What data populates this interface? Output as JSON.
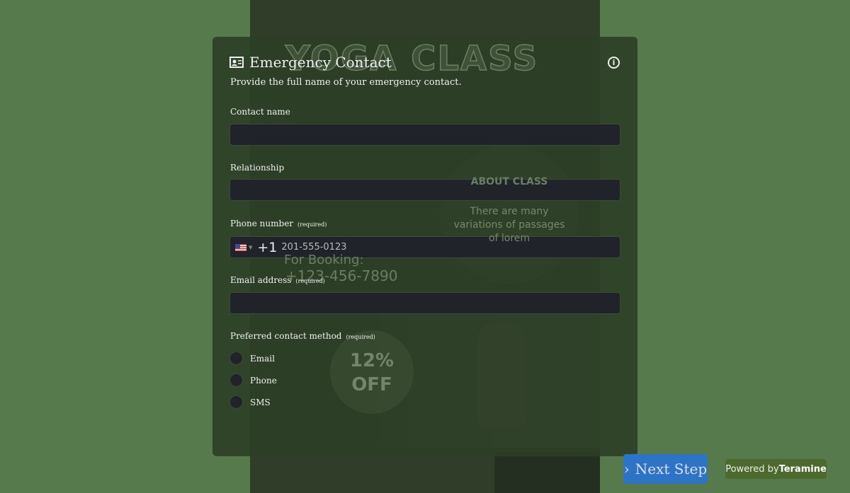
{
  "poster": {
    "title": "YOGA CLASS",
    "about": "ABOUT CLASS",
    "desc": "There are many variations of passages of lorem",
    "booking": "For Booking:",
    "phone": "+123-456-7890",
    "discount": "12% OFF"
  },
  "form": {
    "title": "Emergency Contact",
    "subtitle": "Provide the full name of your emergency contact.",
    "fields": [
      {
        "label": "Contact name",
        "value": ""
      },
      {
        "label": "Relationship",
        "value": ""
      },
      {
        "label": "Phone number",
        "required": "(required)",
        "country_code": "+1",
        "placeholder": "201-555-0123"
      },
      {
        "label": "Email address",
        "required": "(required)",
        "value": ""
      }
    ],
    "contact_method": {
      "label": "Preferred contact method",
      "required": "(required)",
      "options": [
        "Email",
        "Phone",
        "SMS"
      ]
    }
  },
  "footer": {
    "next": "Next Step",
    "powered": "Powered by",
    "brand": "Teramine"
  },
  "colors": {
    "background": "#567a4b",
    "next_button": "#2e74c6",
    "input": "#20232a"
  }
}
